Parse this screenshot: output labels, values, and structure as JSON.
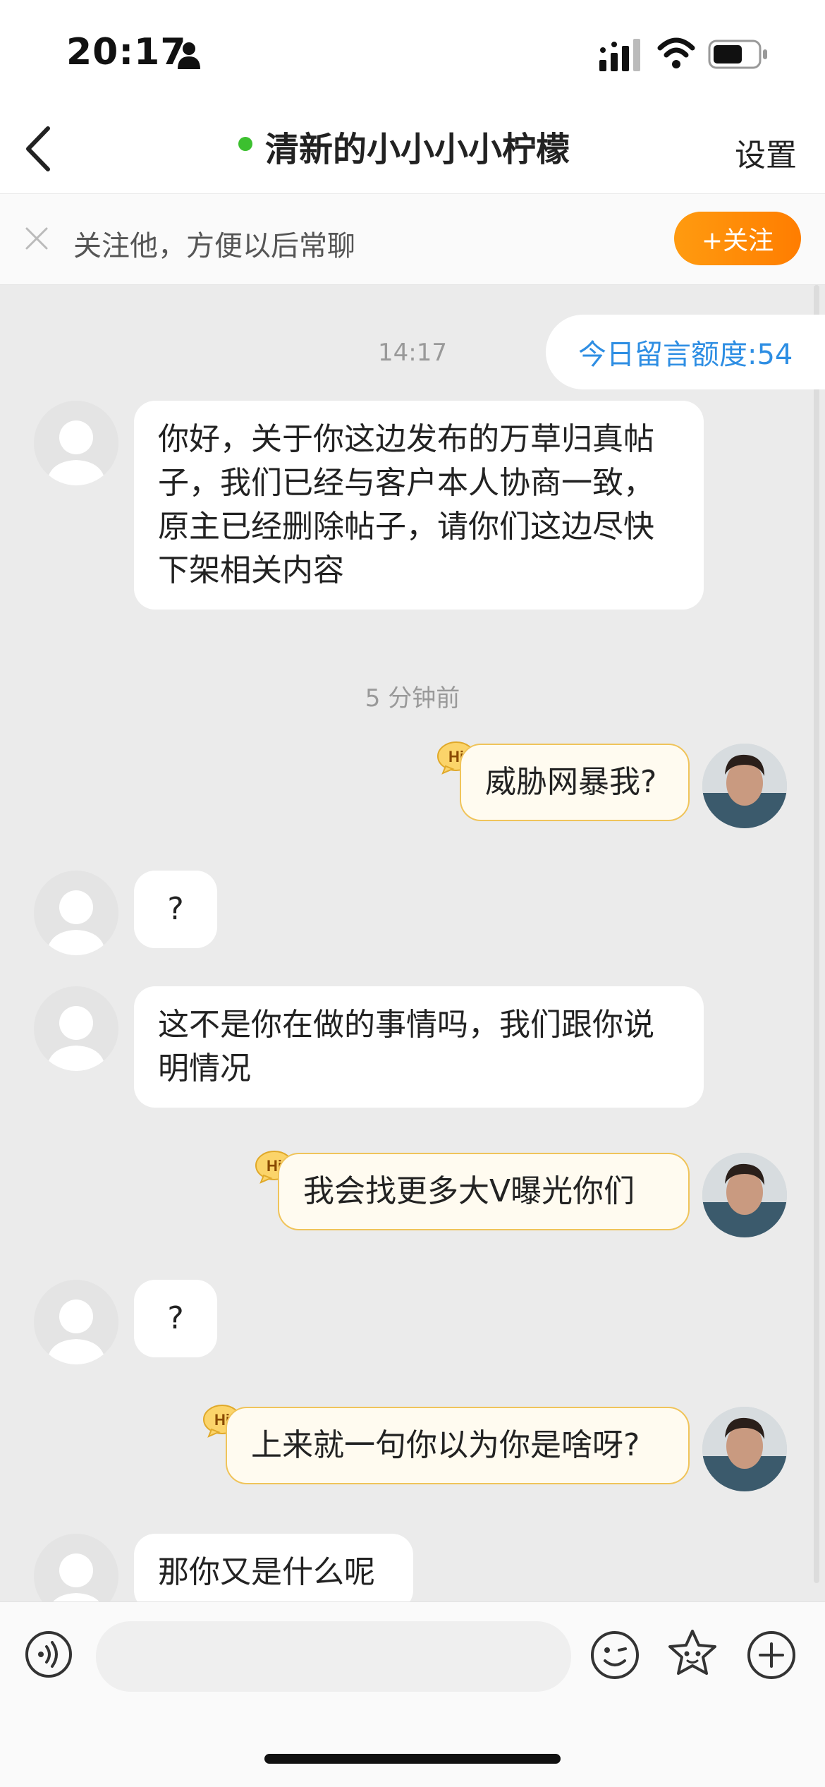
{
  "status_bar": {
    "time": "20:17"
  },
  "nav": {
    "title": "清新的小小小小柠檬",
    "settings": "设置"
  },
  "follow_banner": {
    "text": "关注他，方便以后常聊",
    "button": "+关注"
  },
  "chat": {
    "quota": "今日留言额度:54",
    "timestamp_1": "14:17",
    "msg_1": "你好，关于你这边发布的万草归真帖子，我们已经与客户本人协商一致，原主已经删除帖子，请你们这边尽快下架相关内容",
    "timestamp_2": "5 分钟前",
    "msg_2": "威胁网暴我?",
    "msg_3": "?",
    "msg_4": "这不是你在做的事情吗，我们跟你说明情况",
    "msg_5": "我会找更多大V曝光你们",
    "msg_6": "?",
    "msg_7": "上来就一句你以为你是啥呀?",
    "msg_8": "那你又是什么呢"
  },
  "badge": {
    "hi": "Hi"
  },
  "icons": {
    "back": "chevron-left-icon",
    "close": "close-icon",
    "voice": "voice-icon",
    "emoji": "emoji-icon",
    "sticker": "sticker-icon",
    "plus": "plus-icon"
  },
  "colors": {
    "accent": "#ff8a00",
    "online": "#3cc02f",
    "link": "#2e8ee3",
    "bubble_self": "#fffbf0",
    "bubble_border": "#f0c45a"
  }
}
